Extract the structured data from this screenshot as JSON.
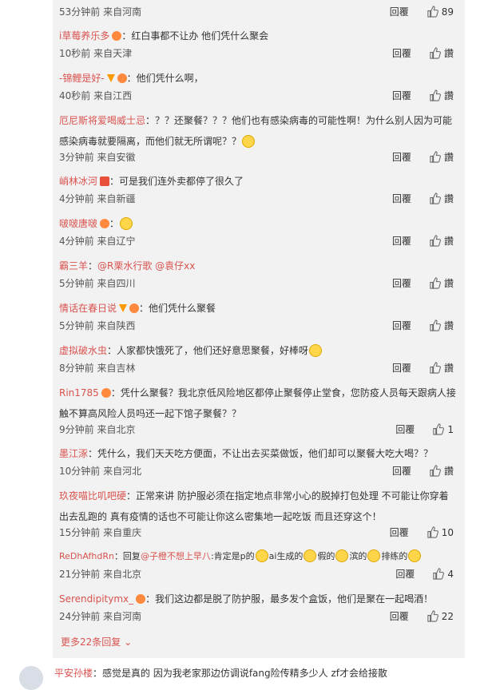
{
  "top": {
    "meta": "53分钟前 来自河南",
    "reply": "回覆",
    "likes": "89"
  },
  "comments": [
    {
      "user": "i草莓养乐多",
      "badges": [
        "b"
      ],
      "text": "：红白事都不让办 他们凭什么聚会",
      "time": "10秒前 来自天津",
      "reply": "回覆",
      "like": "讚"
    },
    {
      "user": "-锦鲤是好-",
      "badges": [
        "v",
        "b"
      ],
      "text": "：他们凭什么啊，",
      "time": "40秒前 来自江西",
      "reply": "回覆",
      "like": "讚"
    },
    {
      "user": "厄尼斯将爱喝威士忌",
      "badges": [],
      "text": "：？？还聚餐？？？他们也有感染病毒的可能性啊！为什么别人因为可能感染病毒就要隔离，而他们就无所谓呢？？",
      "emoji_end": true,
      "time": "3分钟前 来自安徽",
      "reply": "回覆",
      "like": "讚"
    },
    {
      "user": "峭林冰河",
      "badges": [
        "r"
      ],
      "text": "：可是我们连外卖都停了很久了",
      "time": "4分钟前 来自新疆",
      "reply": "回覆",
      "like": "讚"
    },
    {
      "user": "啵啵唐啵",
      "badges": [
        "b"
      ],
      "text": "：",
      "emoji_end": true,
      "time": "4分钟前 来自辽宁",
      "reply": "回覆",
      "like": "讚"
    },
    {
      "user": "霸三羊",
      "badges": [],
      "text": "：",
      "mention": "@R栗水行歌 @袁仔xx",
      "time": "5分钟前 来自四川",
      "reply": "回覆",
      "like": "讚"
    },
    {
      "user": "情话在春日说",
      "badges": [
        "v",
        "b"
      ],
      "text": "：他们凭什么聚餐",
      "time": "5分钟前 来自陕西",
      "reply": "回覆",
      "like": "讚"
    },
    {
      "user": "虚拟破水虫",
      "badges": [],
      "text": "：人家都快饿死了，他们还好意思聚餐，好棒呀",
      "emoji_end": true,
      "time": "8分钟前 来自吉林",
      "reply": "回覆",
      "like": "讚"
    },
    {
      "user": "Rin1785",
      "badges": [
        "b"
      ],
      "text": "：凭什么聚餐？我北京低风险地区都停止聚餐停止堂食，您防疫人员每天跟病人接触不算高风险人员吗还一起下馆子聚餐？？",
      "time": "9分钟前 来自北京",
      "reply": "回覆",
      "like": "1"
    },
    {
      "user": "墨江涿",
      "badges": [],
      "text": "：凭什么，我们天天吃方便面，不让出去买菜做饭，他们却可以聚餐大吃大喝？？",
      "time": "10分钟前 来自河北",
      "reply": "回覆",
      "like": "讚"
    },
    {
      "user": "玖夜喵比叽吧硬",
      "badges": [],
      "text": "：正常来讲 防护服必须在指定地点非常小心的脱掉打包处理 不可能让你穿着出去乱跑的 真有疫情的话也不可能让你这么密集地一起吃饭 而且还穿这个！",
      "time": "15分钟前 来自重庆",
      "reply": "回覆",
      "like": "10"
    },
    {
      "user": "ReDhAfhdRn",
      "badges": [],
      "text": "：回复",
      "mention": "@子橙不想上早八",
      "text2": ":肯定是p的",
      "text3": "ai生成的",
      "text4": "假的",
      "text5": "滨的",
      "text6": "排练的",
      "time": "21分钟前 来自北京",
      "reply": "回覆",
      "like": "4"
    },
    {
      "user": "Serendipitymx_",
      "badges": [
        "b"
      ],
      "text": "：我们这边都是脱了防护服，最多发个盒饭，他们是聚在一起喝酒！",
      "time": "24分钟前 来自河南",
      "reply": "回覆",
      "like": "22"
    }
  ],
  "more_replies": "更多22条回复",
  "bottom": {
    "user": "平安孙楼",
    "text": "：感觉是真的 因为我老家那边仿调说fang险传精多少人 zf才会给接散"
  }
}
